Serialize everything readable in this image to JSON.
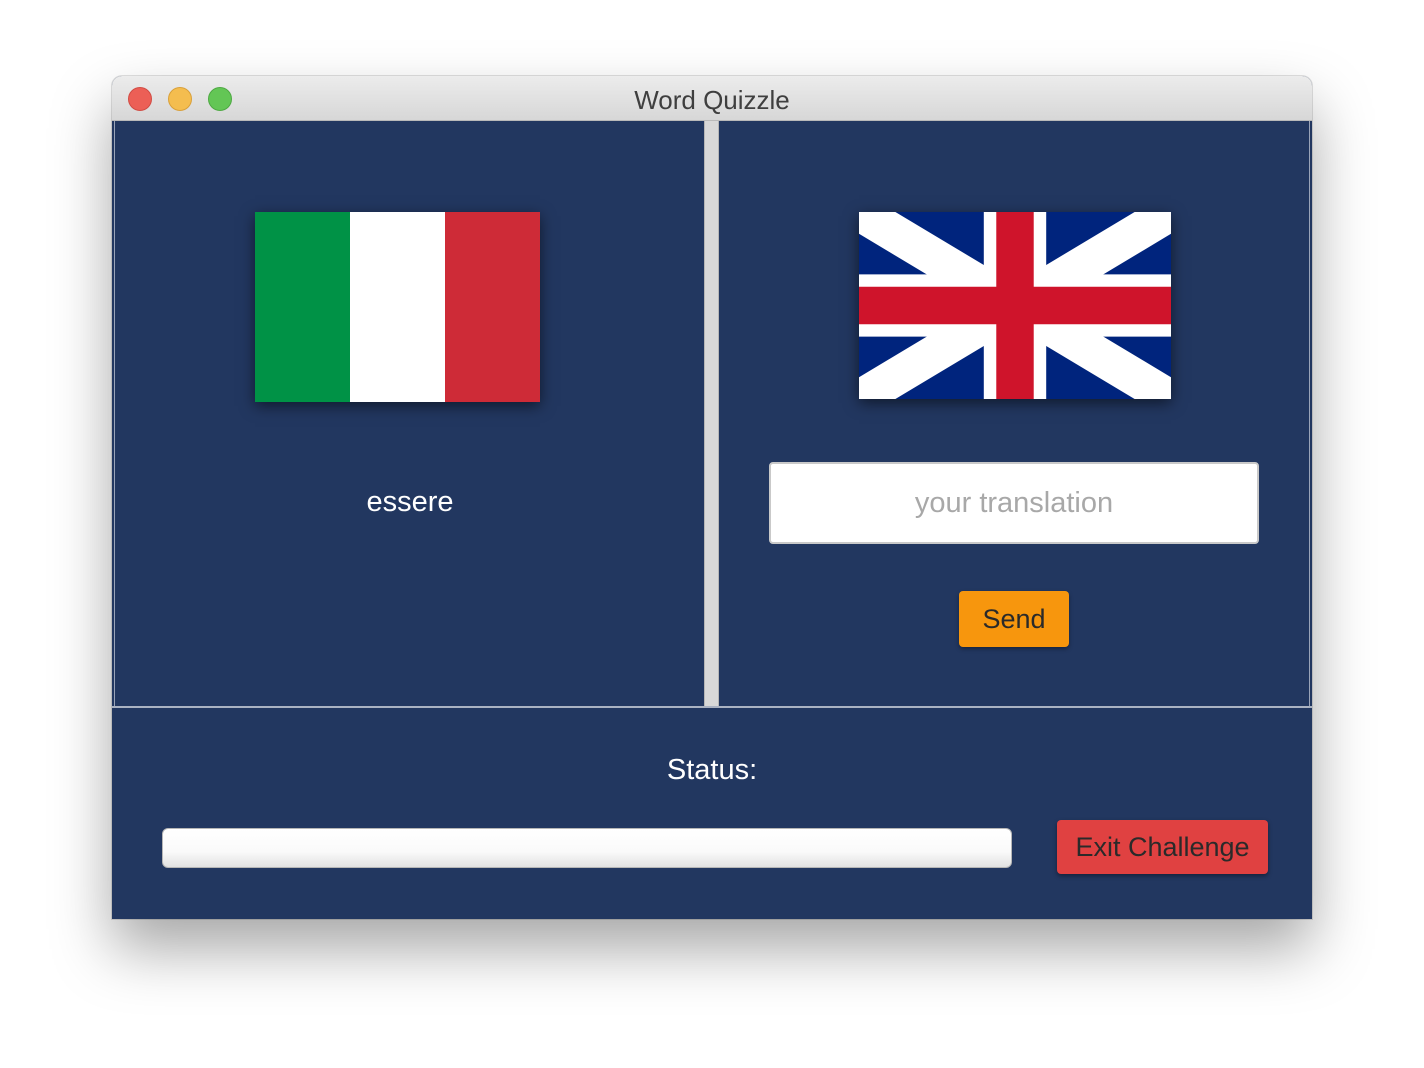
{
  "window": {
    "title": "Word Quizzle"
  },
  "source": {
    "flag": "italy-flag",
    "flag_colors": [
      "#009246",
      "#ffffff",
      "#ce2b37"
    ],
    "word": "essere"
  },
  "target": {
    "flag": "uk-flag",
    "flag_colors": {
      "blue": "#00247d",
      "white": "#ffffff",
      "red": "#cf142b"
    },
    "input_value": "",
    "input_placeholder": "your translation",
    "send_label": "Send"
  },
  "footer": {
    "status_label": "Status:",
    "progress": 0,
    "exit_label": "Exit Challenge"
  },
  "colors": {
    "background": "#223760",
    "send_button": "#f7960d",
    "exit_button": "#e04141"
  }
}
